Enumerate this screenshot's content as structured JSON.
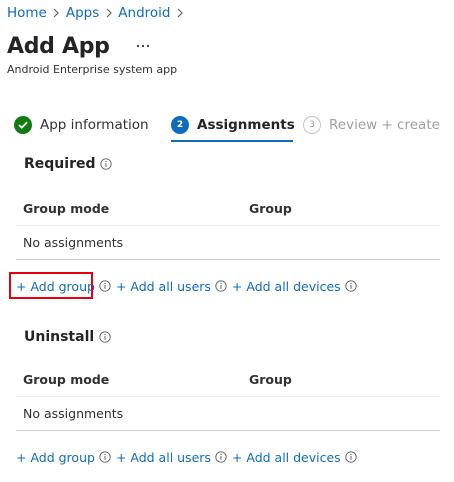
{
  "breadcrumb": {
    "items": [
      "Home",
      "Apps",
      "Android"
    ]
  },
  "header": {
    "title": "Add App",
    "more_label": "...",
    "subtitle": "Android Enterprise system app"
  },
  "wizard": {
    "steps": [
      {
        "number": "1",
        "label": "App information",
        "state": "completed"
      },
      {
        "number": "2",
        "label": "Assignments",
        "state": "active"
      },
      {
        "number": "3",
        "label": "Review + create",
        "state": "inactive"
      }
    ]
  },
  "required": {
    "title": "Required",
    "columns": [
      "Group mode",
      "Group"
    ],
    "empty_text": "No assignments",
    "actions": [
      "+ Add group",
      "+ Add all users",
      "+ Add all devices"
    ]
  },
  "uninstall": {
    "title": "Uninstall",
    "columns": [
      "Group mode",
      "Group"
    ],
    "empty_text": "No assignments",
    "actions": [
      "+ Add group",
      "+ Add all users",
      "+ Add all devices"
    ]
  },
  "colors": {
    "link": "#0f6cbd",
    "completed": "#107c10",
    "highlight": "#e8000d"
  },
  "icons": {
    "check": "checkmark-icon",
    "info": "info-icon",
    "chevron": "chevron-right-icon"
  }
}
